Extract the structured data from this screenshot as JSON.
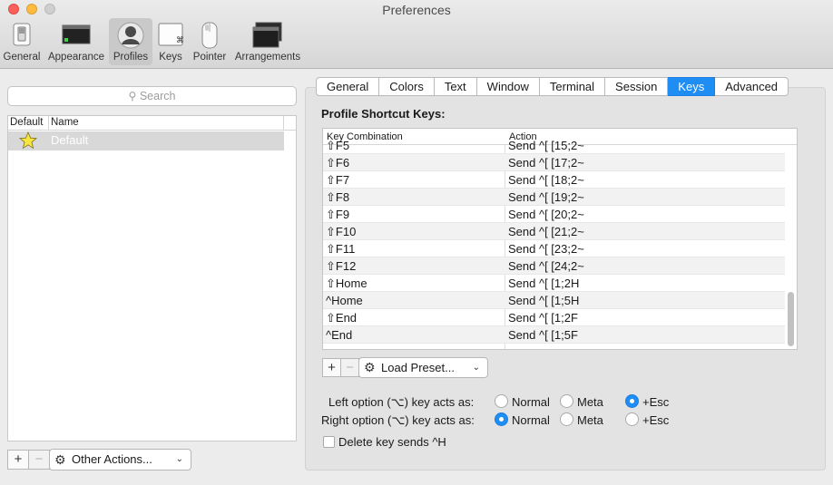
{
  "window": {
    "title": "Preferences"
  },
  "toolbar": {
    "items": [
      {
        "label": "General",
        "icon": "switch-icon"
      },
      {
        "label": "Appearance",
        "icon": "terminal-window-icon"
      },
      {
        "label": "Profiles",
        "icon": "user-silhouette-icon",
        "active": true
      },
      {
        "label": "Keys",
        "icon": "command-key-icon"
      },
      {
        "label": "Pointer",
        "icon": "mouse-icon"
      },
      {
        "label": "Arrangements",
        "icon": "window-stack-icon"
      }
    ]
  },
  "profiles": {
    "search_placeholder": "Search",
    "columns": {
      "default": "Default",
      "name": "Name"
    },
    "rows": [
      {
        "name": "Default",
        "is_default": true
      }
    ],
    "add_label": "+",
    "remove_label": "−",
    "other_actions_label": "Other Actions..."
  },
  "tabs": [
    {
      "label": "General"
    },
    {
      "label": "Colors"
    },
    {
      "label": "Text"
    },
    {
      "label": "Window"
    },
    {
      "label": "Terminal"
    },
    {
      "label": "Session"
    },
    {
      "label": "Keys",
      "selected": true
    },
    {
      "label": "Advanced"
    }
  ],
  "keys_pane": {
    "section_title": "Profile Shortcut Keys:",
    "columns": {
      "combo": "Key Combination",
      "action": "Action"
    },
    "rows": [
      {
        "combo": "⇧F5",
        "action": "Send ^[ [15;2~"
      },
      {
        "combo": "⇧F6",
        "action": "Send ^[ [17;2~"
      },
      {
        "combo": "⇧F7",
        "action": "Send ^[ [18;2~"
      },
      {
        "combo": "⇧F8",
        "action": "Send ^[ [19;2~"
      },
      {
        "combo": "⇧F9",
        "action": "Send ^[ [20;2~"
      },
      {
        "combo": "⇧F10",
        "action": "Send ^[ [21;2~"
      },
      {
        "combo": "⇧F11",
        "action": "Send ^[ [23;2~"
      },
      {
        "combo": "⇧F12",
        "action": "Send ^[ [24;2~"
      },
      {
        "combo": "⇧Home",
        "action": "Send ^[ [1;2H"
      },
      {
        "combo": "^Home",
        "action": "Send ^[ [1;5H"
      },
      {
        "combo": "⇧End",
        "action": "Send ^[ [1;2F"
      },
      {
        "combo": "^End",
        "action": "Send ^[ [1;5F"
      }
    ],
    "add_label": "+",
    "remove_label": "−",
    "load_preset_label": "Load Preset...",
    "left_option": {
      "label": "Left option (⌥) key acts as:",
      "options": [
        "Normal",
        "Meta",
        "+Esc"
      ],
      "selected": "+Esc"
    },
    "right_option": {
      "label": "Right option (⌥) key acts as:",
      "options": [
        "Normal",
        "Meta",
        "+Esc"
      ],
      "selected": "Normal"
    },
    "delete_sends_h": {
      "label": "Delete key sends ^H",
      "checked": false
    }
  },
  "colors": {
    "accent": "#1e8ef5",
    "star": "#f7e640"
  }
}
